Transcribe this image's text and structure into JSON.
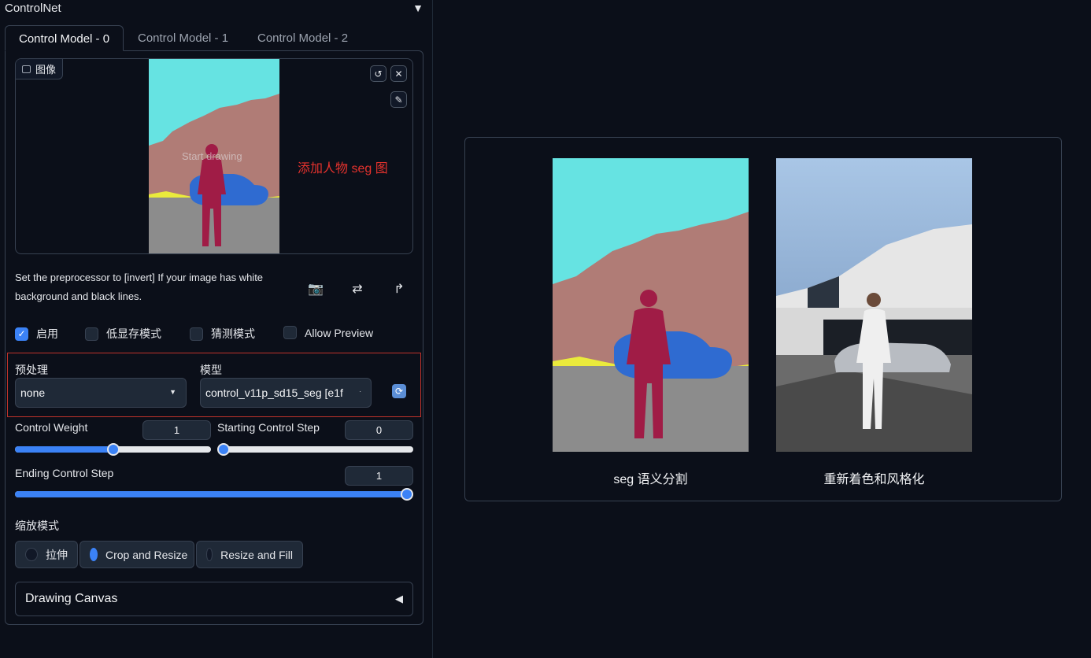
{
  "controlnet": {
    "title": "ControlNet",
    "collapse_icon": "triangle-down-icon",
    "tabs": [
      {
        "label": "Control Model - 0",
        "active": true
      },
      {
        "label": "Control Model - 1",
        "active": false
      },
      {
        "label": "Control Model - 2",
        "active": false
      }
    ],
    "image_input": {
      "label": "图像",
      "placeholder_text": "Start drawing",
      "annotation": "添加人物 seg 图"
    },
    "hint": "Set the preprocessor to [invert] If your image has white background and black lines.",
    "checkboxes": [
      {
        "label": "启用",
        "checked": true
      },
      {
        "label": "低显存模式",
        "checked": false
      },
      {
        "label": "猜测模式",
        "checked": false
      },
      {
        "label": "Allow Preview",
        "checked": false
      }
    ],
    "preprocessor": {
      "label": "预处理",
      "value": "none"
    },
    "model": {
      "label": "模型",
      "value": "control_v11p_sd15_seg [e1f"
    },
    "control_weight": {
      "label": "Control Weight",
      "value": "1",
      "fraction": 0.5
    },
    "starting_step": {
      "label": "Starting Control Step",
      "value": "0",
      "fraction": 0.0
    },
    "ending_step": {
      "label": "Ending Control Step",
      "value": "1",
      "fraction": 1.0
    },
    "resize_mode": {
      "label": "缩放模式",
      "options": [
        {
          "label": "拉伸",
          "selected": false
        },
        {
          "label": "Crop and Resize",
          "selected": true
        },
        {
          "label": "Resize and Fill",
          "selected": false
        }
      ]
    },
    "drawing_canvas": {
      "label": "Drawing Canvas",
      "icon": "triangle-left-icon"
    }
  },
  "gallery": {
    "captions": [
      "seg 语义分割",
      "重新着色和风格化"
    ]
  },
  "colors": {
    "accent": "#3b82f6",
    "highlight_frame": "#c0332b",
    "annotation_text": "#e5322d",
    "background": "#0b0f19"
  }
}
